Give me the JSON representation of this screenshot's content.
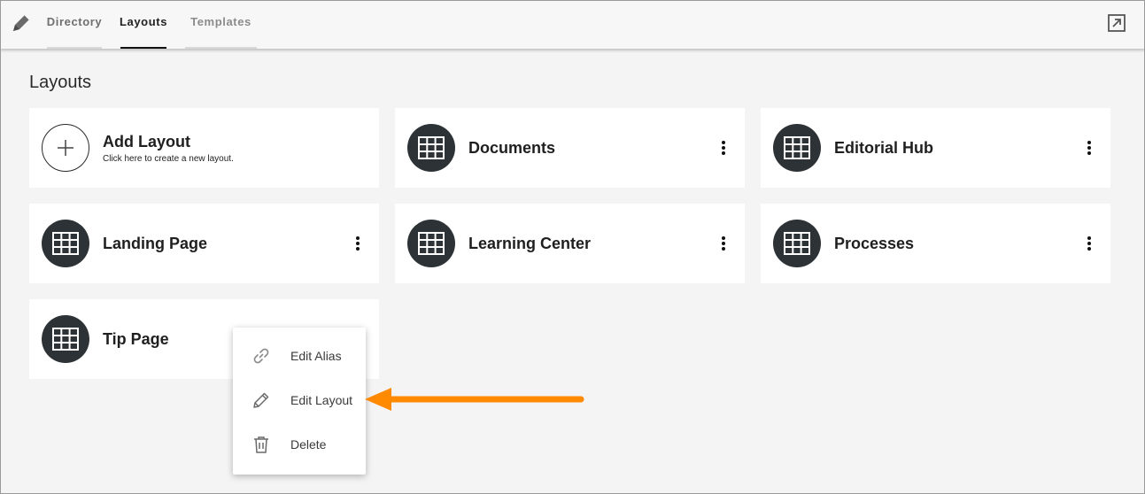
{
  "header": {
    "app_icon": "pencil-icon",
    "tabs": [
      {
        "label": "Directory",
        "state": "inactive"
      },
      {
        "label": "Layouts",
        "state": "active"
      },
      {
        "label": "Templates",
        "state": "inactive"
      }
    ],
    "external_icon": "open-external-icon"
  },
  "main": {
    "title": "Layouts",
    "add_card": {
      "title": "Add Layout",
      "subtitle": "Click here to create a new layout.",
      "icon": "plus-icon"
    },
    "cards": [
      {
        "title": "Documents",
        "icon": "grid-icon"
      },
      {
        "title": "Editorial Hub",
        "icon": "grid-icon"
      },
      {
        "title": "Landing Page",
        "icon": "grid-icon"
      },
      {
        "title": "Learning Center",
        "icon": "grid-icon"
      },
      {
        "title": "Processes",
        "icon": "grid-icon"
      },
      {
        "title": "Tip Page",
        "icon": "grid-icon"
      }
    ]
  },
  "context_menu": {
    "items": [
      {
        "label": "Edit Alias",
        "icon": "link-icon"
      },
      {
        "label": "Edit Layout",
        "icon": "pencil-icon"
      },
      {
        "label": "Delete",
        "icon": "trash-icon"
      }
    ]
  },
  "colors": {
    "accent_arrow": "#ff8a00",
    "badge_bg": "#2c3235",
    "page_bg": "#f4f4f4",
    "card_bg": "#ffffff"
  }
}
